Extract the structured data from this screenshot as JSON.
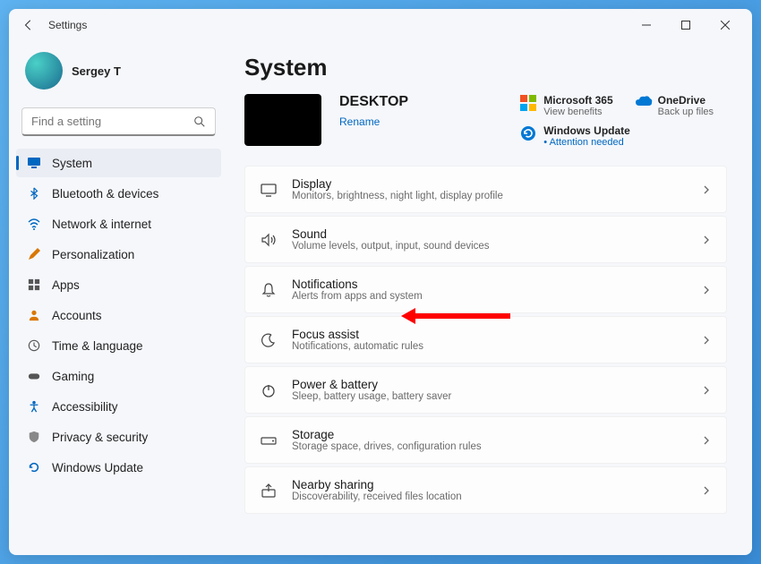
{
  "titlebar": {
    "title": "Settings"
  },
  "profile": {
    "name": "Sergey T"
  },
  "search": {
    "placeholder": "Find a setting"
  },
  "nav": [
    {
      "label": "System"
    },
    {
      "label": "Bluetooth & devices"
    },
    {
      "label": "Network & internet"
    },
    {
      "label": "Personalization"
    },
    {
      "label": "Apps"
    },
    {
      "label": "Accounts"
    },
    {
      "label": "Time & language"
    },
    {
      "label": "Gaming"
    },
    {
      "label": "Accessibility"
    },
    {
      "label": "Privacy & security"
    },
    {
      "label": "Windows Update"
    }
  ],
  "page": {
    "title": "System"
  },
  "device": {
    "name": "DESKTOP",
    "rename": "Rename"
  },
  "promos": {
    "m365": {
      "title": "Microsoft 365",
      "sub": "View benefits"
    },
    "onedrive": {
      "title": "OneDrive",
      "sub": "Back up files"
    },
    "update": {
      "title": "Windows Update",
      "sub": "Attention needed",
      "bullet": "•"
    }
  },
  "settings": [
    {
      "title": "Display",
      "sub": "Monitors, brightness, night light, display profile"
    },
    {
      "title": "Sound",
      "sub": "Volume levels, output, input, sound devices"
    },
    {
      "title": "Notifications",
      "sub": "Alerts from apps and system"
    },
    {
      "title": "Focus assist",
      "sub": "Notifications, automatic rules"
    },
    {
      "title": "Power & battery",
      "sub": "Sleep, battery usage, battery saver"
    },
    {
      "title": "Storage",
      "sub": "Storage space, drives, configuration rules"
    },
    {
      "title": "Nearby sharing",
      "sub": "Discoverability, received files location"
    }
  ]
}
